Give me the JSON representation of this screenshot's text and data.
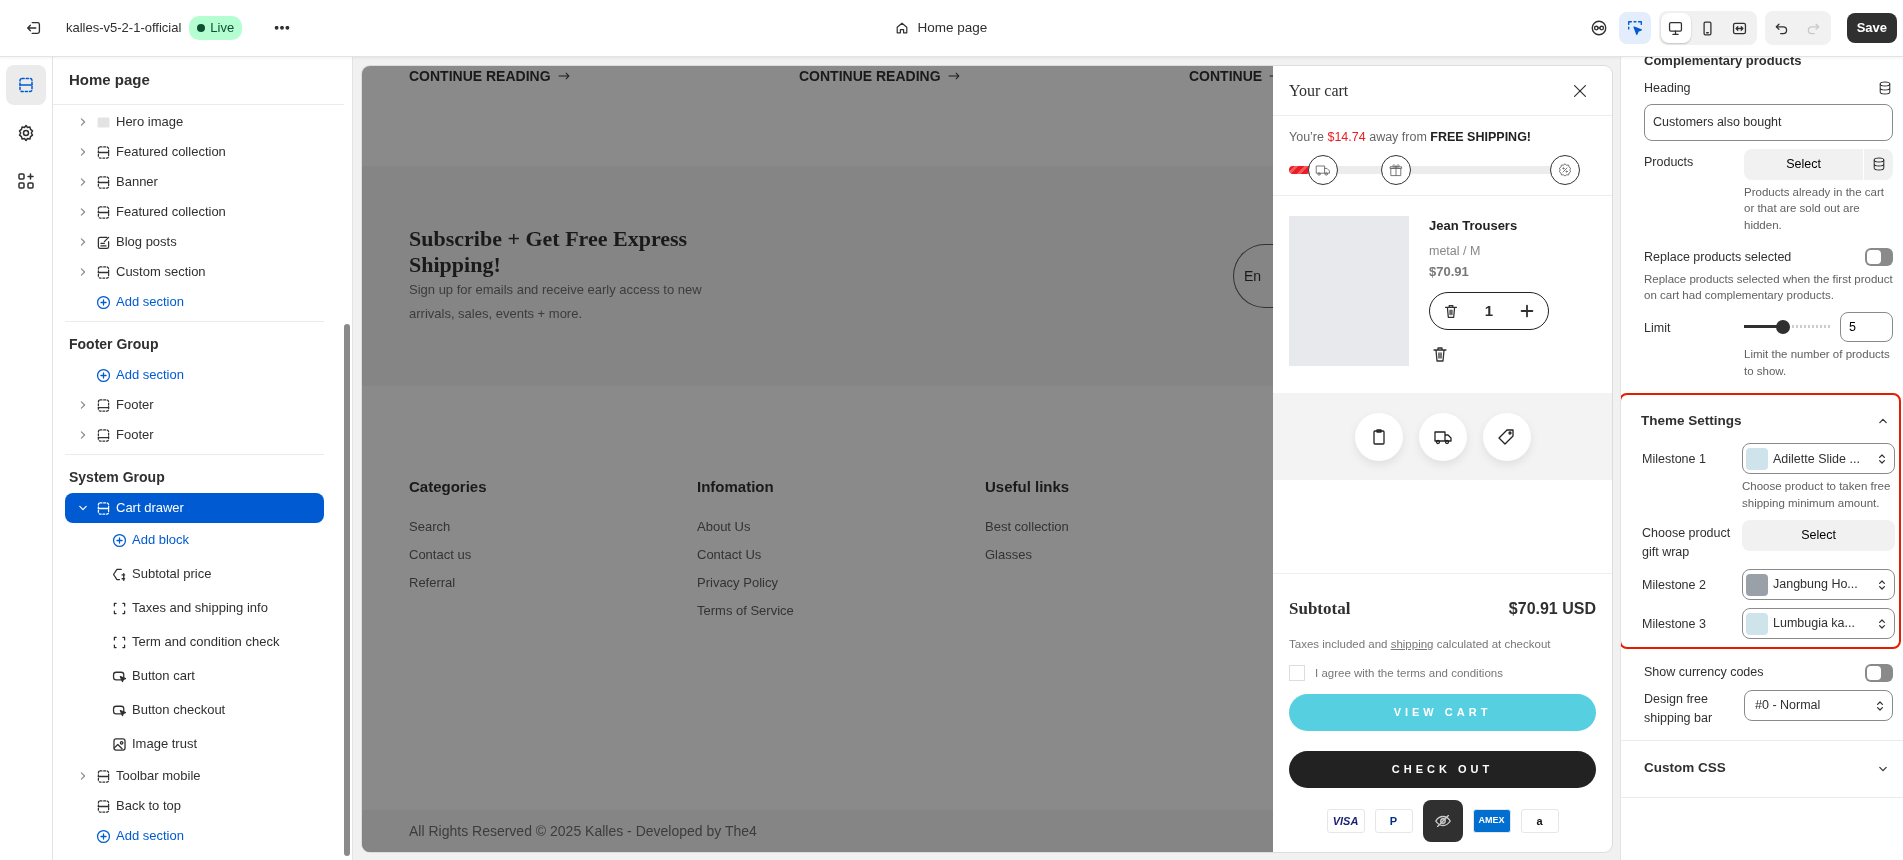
{
  "topbar": {
    "store_name": "kalles-v5-2-1-official",
    "status": "Live",
    "live": true,
    "page_title": "Home page",
    "inspector_on": true,
    "view_modes": [
      {
        "kind": "desktop",
        "selected": true
      },
      {
        "kind": "mobile",
        "selected": false
      },
      {
        "kind": "fullwidth",
        "selected": false
      }
    ],
    "redo_disabled": true,
    "save": "Save"
  },
  "rail": [
    {
      "kind": "sections",
      "selected": true
    },
    {
      "kind": "settings",
      "selected": false
    },
    {
      "kind": "apps",
      "selected": false
    }
  ],
  "sidebar": {
    "title": "Home page",
    "groups": [
      {
        "items": [
          {
            "kind": "image-section",
            "label": "Hero image",
            "expandable": true,
            "expanded": false,
            "selected": false
          },
          {
            "kind": "section",
            "label": "Featured collection",
            "expandable": true,
            "expanded": false,
            "selected": false
          },
          {
            "kind": "section",
            "label": "Banner",
            "expandable": true,
            "expanded": false,
            "selected": false
          },
          {
            "kind": "section",
            "label": "Featured collection",
            "expandable": true,
            "expanded": false,
            "selected": false
          },
          {
            "kind": "blog-section",
            "label": "Blog posts",
            "expandable": true,
            "expanded": false,
            "selected": false
          },
          {
            "kind": "section",
            "label": "Custom section",
            "expandable": true,
            "expanded": false,
            "selected": false
          },
          {
            "kind": "add",
            "label": "Add section"
          }
        ]
      },
      {
        "title": "Footer Group",
        "items": [
          {
            "kind": "add",
            "label": "Add section"
          },
          {
            "kind": "footer-section",
            "label": "Footer",
            "expandable": true,
            "expanded": false,
            "selected": false
          },
          {
            "kind": "footer-section",
            "label": "Footer",
            "expandable": true,
            "expanded": false,
            "selected": false
          }
        ]
      },
      {
        "title": "System Group",
        "items": [
          {
            "kind": "section",
            "label": "Cart drawer",
            "expandable": true,
            "expanded": true,
            "selected": true,
            "children": [
              {
                "kind": "add",
                "label": "Add block"
              },
              {
                "kind": "price-block",
                "label": "Subtotal price",
                "selected": false
              },
              {
                "kind": "info-block",
                "label": "Taxes and shipping info",
                "selected": false
              },
              {
                "kind": "info-block",
                "label": "Term and condition check",
                "selected": false
              },
              {
                "kind": "button-block",
                "label": "Button cart",
                "selected": false
              },
              {
                "kind": "button-block",
                "label": "Button checkout",
                "selected": false
              },
              {
                "kind": "image-block",
                "label": "Image trust",
                "selected": false
              }
            ]
          },
          {
            "kind": "section",
            "label": "Toolbar mobile",
            "expandable": true,
            "expanded": false,
            "selected": false
          },
          {
            "kind": "section",
            "label": "Back to top",
            "expandable": false,
            "selected": false
          },
          {
            "kind": "add",
            "label": "Add section"
          }
        ]
      }
    ]
  },
  "preview": {
    "blog_links": [
      "CONTINUE READING",
      "CONTINUE READING",
      "CONTINUE"
    ],
    "newsletter": {
      "heading": "Subscribe + Get Free Express Shipping!",
      "text": "Sign up for emails and receive early access to new arrivals, sales, events + more.",
      "field_partial": "En"
    },
    "footer_columns": [
      {
        "title": "Categories",
        "links": [
          "Search",
          "Contact us",
          "Referral"
        ]
      },
      {
        "title": "Infomation",
        "links": [
          "About Us",
          "Contact Us",
          "Privacy Policy",
          "Terms of Service"
        ]
      },
      {
        "title": "Useful links",
        "links": [
          "Best collection",
          "Glasses"
        ]
      }
    ],
    "copyright": {
      "before": "All Rights Reserved © 2025 ",
      "brand": "Kalles",
      "middle": " - Developed by ",
      "developer": "The4"
    }
  },
  "cart": {
    "title": "Your cart",
    "shipping": {
      "before": "You’re ",
      "amount": "$14.74",
      "after": " away from ",
      "goal": "FREE SHIPPING!",
      "level": 0.15,
      "milestones": [
        {
          "kind": "truck"
        },
        {
          "kind": "gift"
        },
        {
          "kind": "discount"
        }
      ]
    },
    "items": [
      {
        "name": "Jean Trousers",
        "variant": "metal / M",
        "price": "$70.91",
        "quantity": "1"
      }
    ],
    "upsell_tools": [
      {
        "kind": "note"
      },
      {
        "kind": "shipping"
      },
      {
        "kind": "coupon"
      }
    ],
    "subtotal_label": "Subtotal",
    "subtotal": "$70.91 USD",
    "taxes": {
      "before": "Taxes included and ",
      "link": "shipping",
      "after": " calculated at checkout"
    },
    "terms": {
      "label": "I agree with the terms and conditions",
      "checked": false
    },
    "view_cart": "VIEW CART",
    "checkout": "CHECK OUT",
    "payments": [
      {
        "kind": "visa",
        "label": "VISA"
      },
      {
        "kind": "paypal",
        "label": "P"
      },
      {
        "kind": "amex",
        "label": "AMEX"
      },
      {
        "kind": "amazon",
        "label": "a"
      }
    ]
  },
  "settings": {
    "section_partial": "Complementary products",
    "fields": [
      {
        "kind": "text",
        "label": "Heading",
        "value": "Customers also bought",
        "dynamic": true
      },
      {
        "kind": "picker",
        "label": "Products",
        "button": "Select",
        "dynamic": true,
        "help": "Products already in the cart or that are sold out are hidden."
      },
      {
        "kind": "toggle",
        "label": "Replace products selected",
        "on": false,
        "help": "Replace products selected when the first product on cart had complementary products."
      },
      {
        "kind": "range",
        "label": "Limit",
        "level": 0.44,
        "value": "5",
        "help": "Limit the number of products to show."
      }
    ],
    "theme_settings": {
      "title": "Theme Settings",
      "expanded": true,
      "highlighted": true,
      "fields": [
        {
          "kind": "product",
          "label": "Milestone 1",
          "value": "Adilette Slide ...",
          "help": "Choose product to taken free shipping minimum amount."
        },
        {
          "kind": "picker",
          "label": "Choose product gift wrap",
          "button": "Select"
        },
        {
          "kind": "product",
          "label": "Milestone 2",
          "value": "Jangbung Ho..."
        },
        {
          "kind": "product",
          "label": "Milestone 3",
          "value": "Lumbugia ka..."
        }
      ]
    },
    "after_fields": [
      {
        "kind": "toggle",
        "label": "Show currency codes",
        "on": false
      },
      {
        "kind": "select",
        "label": "Design free shipping bar",
        "value": "#0 - Normal"
      }
    ],
    "custom_css": {
      "title": "Custom CSS",
      "expanded": false
    }
  }
}
